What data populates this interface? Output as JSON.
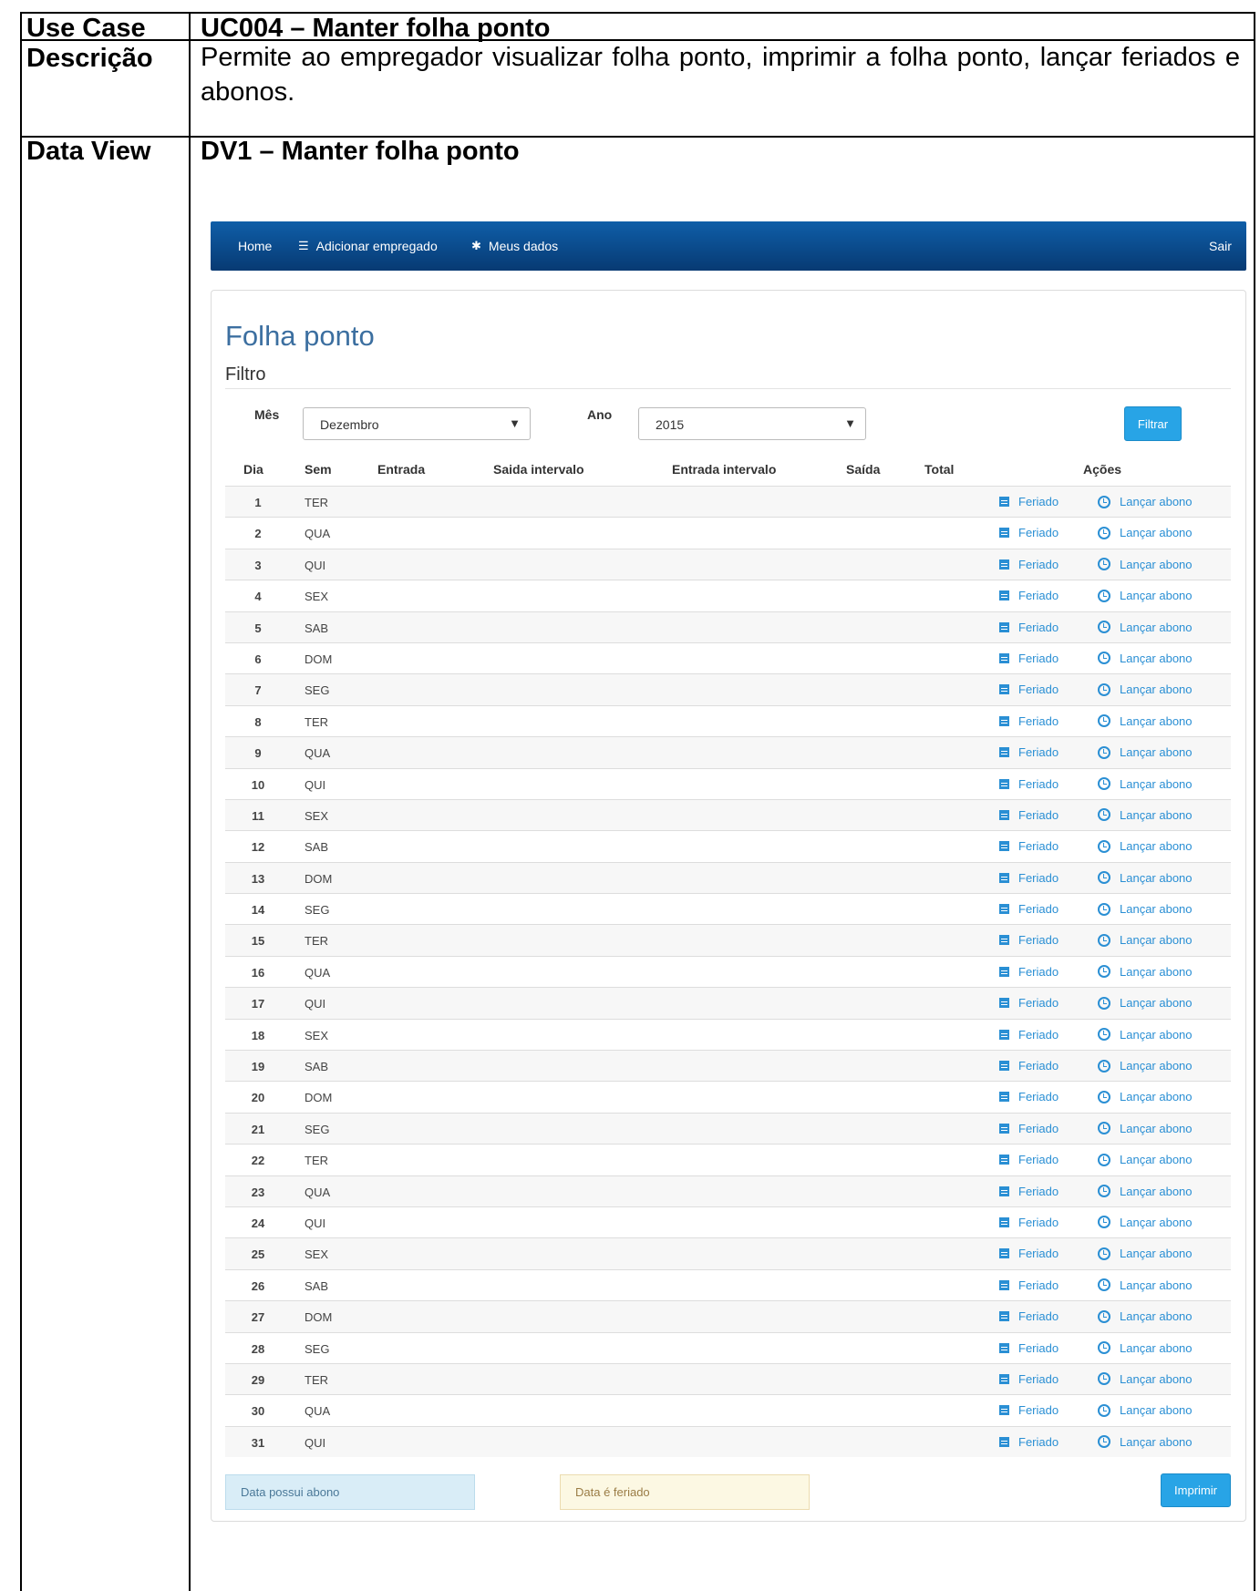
{
  "doc": {
    "use_case_label": "Use Case",
    "use_case_value": "UC004 – Manter folha ponto",
    "descricao_label": "Descrição",
    "descricao_value": "Permite ao empregador visualizar folha ponto, imprimir a folha ponto, lançar feriados e abonos.",
    "data_view_label": "Data View",
    "data_view_value": "DV1 – Manter folha ponto"
  },
  "nav": {
    "home": "Home",
    "add_employee": "Adicionar empregado",
    "my_data": "Meus dados",
    "logout": "Sair",
    "add_employee_icon": "list-icon",
    "my_data_icon": "gear-icon"
  },
  "page": {
    "title": "Folha ponto",
    "filter_title": "Filtro",
    "month_label": "Mês",
    "month_value": "Dezembro",
    "year_label": "Ano",
    "year_value": "2015",
    "filter_button": "Filtrar",
    "print_button": "Imprimir"
  },
  "table": {
    "headers": {
      "dia": "Dia",
      "sem": "Sem",
      "entrada": "Entrada",
      "saida_intervalo": "Saida intervalo",
      "entrada_intervalo": "Entrada intervalo",
      "saida": "Saída",
      "total": "Total",
      "acoes": "Ações"
    },
    "action_feriado": "Feriado",
    "action_abono": "Lançar abono",
    "rows": [
      {
        "dia": "1",
        "sem": "TER"
      },
      {
        "dia": "2",
        "sem": "QUA"
      },
      {
        "dia": "3",
        "sem": "QUI"
      },
      {
        "dia": "4",
        "sem": "SEX"
      },
      {
        "dia": "5",
        "sem": "SAB"
      },
      {
        "dia": "6",
        "sem": "DOM"
      },
      {
        "dia": "7",
        "sem": "SEG"
      },
      {
        "dia": "8",
        "sem": "TER"
      },
      {
        "dia": "9",
        "sem": "QUA"
      },
      {
        "dia": "10",
        "sem": "QUI"
      },
      {
        "dia": "11",
        "sem": "SEX"
      },
      {
        "dia": "12",
        "sem": "SAB"
      },
      {
        "dia": "13",
        "sem": "DOM"
      },
      {
        "dia": "14",
        "sem": "SEG"
      },
      {
        "dia": "15",
        "sem": "TER"
      },
      {
        "dia": "16",
        "sem": "QUA"
      },
      {
        "dia": "17",
        "sem": "QUI"
      },
      {
        "dia": "18",
        "sem": "SEX"
      },
      {
        "dia": "19",
        "sem": "SAB"
      },
      {
        "dia": "20",
        "sem": "DOM"
      },
      {
        "dia": "21",
        "sem": "SEG"
      },
      {
        "dia": "22",
        "sem": "TER"
      },
      {
        "dia": "23",
        "sem": "QUA"
      },
      {
        "dia": "24",
        "sem": "QUI"
      },
      {
        "dia": "25",
        "sem": "SEX"
      },
      {
        "dia": "26",
        "sem": "SAB"
      },
      {
        "dia": "27",
        "sem": "DOM"
      },
      {
        "dia": "28",
        "sem": "SEG"
      },
      {
        "dia": "29",
        "sem": "TER"
      },
      {
        "dia": "30",
        "sem": "QUA"
      },
      {
        "dia": "31",
        "sem": "QUI"
      }
    ]
  },
  "legend": {
    "abono": "Data possui abono",
    "feriado": "Data é feriado"
  },
  "colors": {
    "nav_top": "#0f5ea8",
    "nav_bottom": "#073a73",
    "accent": "#28a4e6",
    "link": "#2a8fd4",
    "abono_bg": "#d9edf7",
    "feriado_bg": "#fcf8e3"
  }
}
